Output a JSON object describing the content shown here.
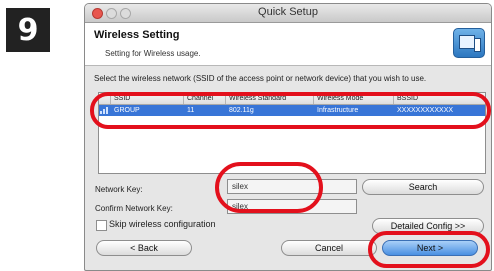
{
  "step_number": "9",
  "window": {
    "title": "Quick Setup"
  },
  "header": {
    "title": "Wireless Setting",
    "subtitle": "Setting for Wireless usage.",
    "icon": "wireless-setup-icon"
  },
  "instruction": "Select the wireless network (SSID of the access point or network device) that you wish to use.",
  "table": {
    "columns": [
      "SSID",
      "Channel",
      "Wireless Standard",
      "Wireless Mode",
      "BSSID"
    ],
    "rows": [
      {
        "signal_icon": "signal-strength-icon",
        "ssid": "GROUP",
        "channel": "11",
        "standard": "802.11g",
        "mode": "Infrastructure",
        "bssid": "XXXXXXXXXXXX",
        "selected": true
      }
    ]
  },
  "network_key": {
    "label": "Network Key:",
    "value": "silex"
  },
  "confirm_key": {
    "label": "Confirm Network Key:",
    "value": "silex"
  },
  "buttons": {
    "search": "Search",
    "detailed_config": "Detailed Config >>",
    "back": "< Back",
    "cancel": "Cancel",
    "next": "Next >"
  },
  "skip_checkbox": {
    "label": "Skip wireless configuration",
    "checked": false
  },
  "colors": {
    "highlight": "#e3101c",
    "selection": "#3875d7",
    "step_badge": "#222222"
  }
}
